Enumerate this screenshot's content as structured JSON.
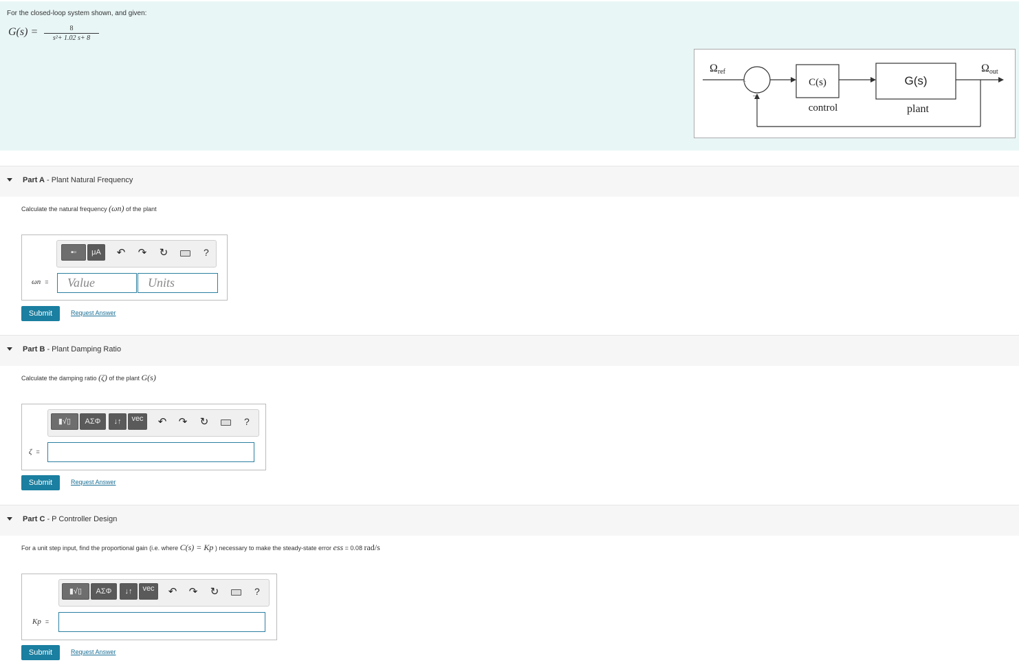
{
  "intro": {
    "text": "For the closed-loop system shown, and given:",
    "formula": {
      "lhs": "G(s) =",
      "numerator": "8",
      "denominator": "s²+ 1.02 s+ 8"
    }
  },
  "diagram": {
    "input_label": "Ω",
    "input_sub": "ref",
    "output_label": "Ω",
    "output_sub": "out",
    "plus_sign": "+",
    "minus_sign": "–",
    "controller_label": "C(s)",
    "controller_caption": "control",
    "plant_label": "G(s)",
    "plant_caption": "plant"
  },
  "parts": {
    "a": {
      "part": "Part A",
      "title": " - Plant Natural Frequency",
      "prompt_pre": "Calculate the natural frequency ",
      "prompt_math": "(ωn)",
      "prompt_post": " of the plant",
      "toolbar": {
        "b1": "▪▫",
        "b2": "μA"
      },
      "var": "ωn",
      "eq": "=",
      "value_placeholder": "Value",
      "units_placeholder": "Units",
      "submit": "Submit",
      "request": "Request Answer"
    },
    "b": {
      "part": "Part B",
      "title": " - Plant Damping Ratio",
      "prompt_pre": "Calculate the damping ratio ",
      "prompt_math": "(ζ)",
      "prompt_mid": " of the plant ",
      "prompt_math2": "G(s)",
      "toolbar": {
        "b1": "▮√▯",
        "b2": "ΑΣΦ",
        "b3": "↓↑",
        "b4": "vec"
      },
      "var": "ζ",
      "eq": "=",
      "submit": "Submit",
      "request": "Request Answer"
    },
    "c": {
      "part": "Part C",
      "title": " - P Controller Design",
      "prompt_pre": "For a unit step input, find the proportional gain (i.e. where ",
      "prompt_math": "C(s) = Kp",
      "prompt_mid": " ) necessary to make the steady-state error ",
      "prompt_math2": "ess",
      "prompt_post": " = 0.08 ",
      "prompt_units": "rad/s",
      "toolbar": {
        "b1": "▮√▯",
        "b2": "ΑΣΦ",
        "b3": "↓↑",
        "b4": "vec"
      },
      "var": "Kp",
      "eq": "=",
      "submit": "Submit",
      "request": "Request Answer"
    }
  },
  "toolbar_common": {
    "undo": "↶",
    "redo": "↷",
    "reset": "↻",
    "help": "?"
  }
}
